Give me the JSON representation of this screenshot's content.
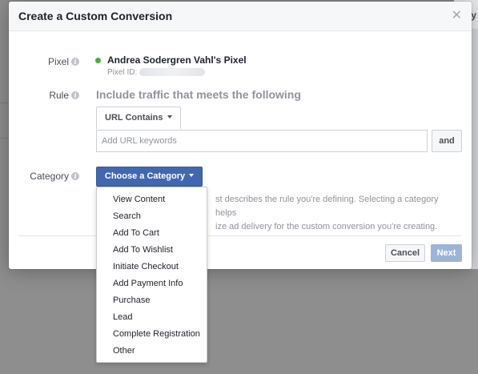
{
  "background": {
    "peek_text": "ity"
  },
  "dialog": {
    "title": "Create a Custom Conversion",
    "close_icon": "✕"
  },
  "pixel": {
    "label": "Pixel",
    "name": "Andrea Sodergren Vahl's Pixel",
    "id_label": "Pixel ID:"
  },
  "rule": {
    "label": "Rule",
    "heading": "Include traffic that meets the following",
    "condition_select": "URL Contains",
    "url_placeholder": "Add URL keywords",
    "and_label": "and"
  },
  "category": {
    "label": "Category",
    "button_label": "Choose a Category",
    "help_text_line1": "st describes the rule you're defining. Selecting a category helps",
    "help_text_line2": "ize ad delivery for the custom conversion you're creating.",
    "options": [
      "View Content",
      "Search",
      "Add To Cart",
      "Add To Wishlist",
      "Initiate Checkout",
      "Add Payment Info",
      "Purchase",
      "Lead",
      "Complete Registration",
      "Other"
    ]
  },
  "footer": {
    "cancel_label": "Cancel",
    "next_label": "Next"
  },
  "colors": {
    "primary_button": "#4267b2",
    "disabled_button": "#9cb4d8",
    "status_dot": "#42b72a"
  }
}
